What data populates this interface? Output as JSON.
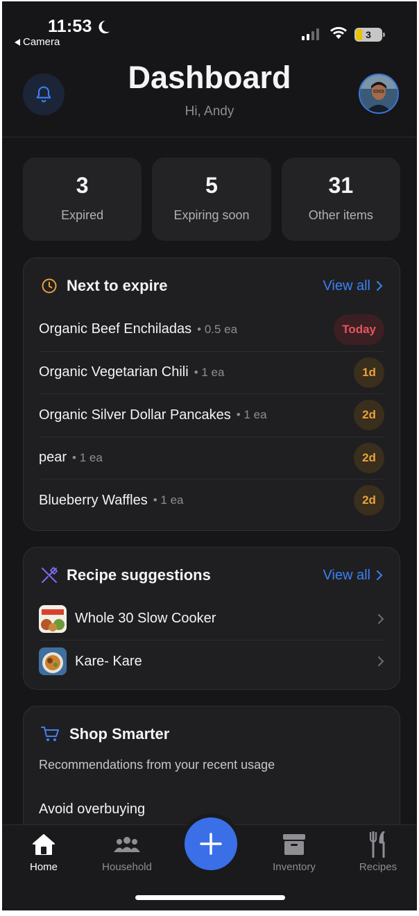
{
  "status_bar": {
    "time": "11:53",
    "back_label": "Camera",
    "battery": "3"
  },
  "header": {
    "title": "Dashboard",
    "greeting": "Hi, Andy"
  },
  "stats": [
    {
      "value": "3",
      "label": "Expired"
    },
    {
      "value": "5",
      "label": "Expiring soon"
    },
    {
      "value": "31",
      "label": "Other items"
    }
  ],
  "next_to_expire": {
    "title": "Next to expire",
    "view_all": "View all",
    "items": [
      {
        "name": "Organic Beef Enchiladas",
        "qty": "• 0.5 ea",
        "badge": "Today"
      },
      {
        "name": "Organic Vegetarian Chili",
        "qty": "• 1 ea",
        "badge": "1d"
      },
      {
        "name": "Organic Silver Dollar Pancakes",
        "qty": "• 1 ea",
        "badge": "2d"
      },
      {
        "name": "pear",
        "qty": "• 1 ea",
        "badge": "2d"
      },
      {
        "name": "Blueberry Waffles",
        "qty": "• 1 ea",
        "badge": "2d"
      }
    ]
  },
  "recipes": {
    "title": "Recipe suggestions",
    "view_all": "View all",
    "items": [
      {
        "name": "Whole 30 Slow Cooker"
      },
      {
        "name": "Kare- Kare"
      }
    ]
  },
  "shop": {
    "title": "Shop Smarter",
    "subtitle": "Recommendations from your recent usage",
    "section": "Avoid overbuying"
  },
  "tabs": [
    {
      "label": "Home"
    },
    {
      "label": "Household"
    },
    {
      "label": "Inventory"
    },
    {
      "label": "Recipes"
    }
  ],
  "colors": {
    "accent": "#3a6fe8",
    "link": "#3a82f7",
    "today_badge": "#e2575f",
    "soon_badge": "#e8a23c",
    "clock_icon": "#e8a23c",
    "utensils_icon": "#7b6cf6",
    "cart_icon": "#4a7df0"
  }
}
